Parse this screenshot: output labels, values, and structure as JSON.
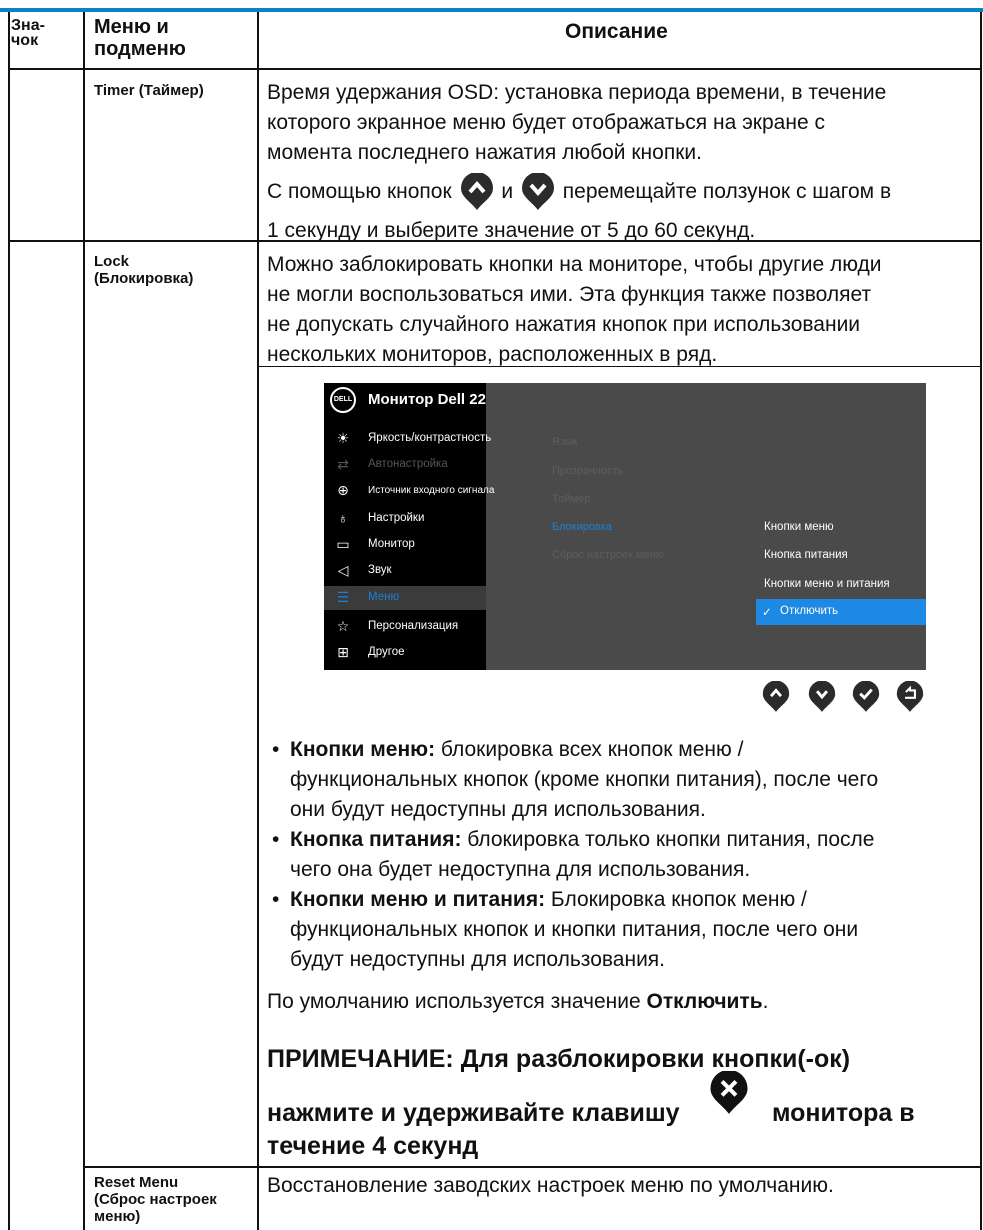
{
  "header": {
    "icon_col": "Зна-\nчок",
    "menu_col": "Меню и\nподменю",
    "desc_col": "Описание"
  },
  "rows": {
    "timer": {
      "label": "Timer (Таймер)",
      "line1": "Время удержания OSD: установка периода времени, в течение",
      "line2": "которого экранное меню будет отображаться на экране с",
      "line3": "момента последнего нажатия любой кнопки.",
      "line4a": "С помощью кнопок",
      "line4b": "и",
      "line4c": "перемещайте ползунок с шагом в",
      "line5": "1 секунду и выберите значение от 5 до 60 секунд."
    },
    "lock": {
      "label1": "Lock",
      "label2": "(Блокировка)",
      "line1": "Можно заблокировать кнопки на мониторе, чтобы другие люди",
      "line2": "не могли воспользоваться ими. Эта функция также позволяет",
      "line3": "не допускать случайного нажатия кнопок при использовании",
      "line4": "нескольких мониторов, расположенных в ряд.",
      "bullets": [
        {
          "bold": "Кнопки меню:",
          "l1": " блокировка всех кнопок меню /",
          "l2": "функциональных кнопок (кроме кнопки питания), после чего",
          "l3": "они будут недоступны для использования."
        },
        {
          "bold": "Кнопка питания:",
          "l1": " блокировка только кнопки питания, после",
          "l2": "чего она будет недоступна для использования.",
          "l3": ""
        },
        {
          "bold": "Кнопки меню и питания:",
          "l1": " Блокировка кнопок меню /",
          "l2": "функциональных кнопок и кнопки питания, после чего они",
          "l3": "будут недоступны для использования."
        }
      ],
      "default_pre": "По умолчанию используется значение ",
      "default_bold": "Отключить",
      "default_post": ".",
      "note1": "ПРИМЕЧАНИЕ: Для разблокировки кнопки(-ок)",
      "note2a": "нажмите и удерживайте клавишу",
      "note2b": "монитора в",
      "note3": "течение 4 секунд"
    },
    "reset": {
      "label1": "Reset Menu",
      "label2": "(Сброс настроек",
      "label3": "меню)",
      "desc": "Восстановление заводских настроек меню по умолчанию."
    }
  },
  "osd": {
    "logo": "DELL",
    "title": "Монитор Dell 22",
    "left_items": [
      {
        "icon": "sun-icon",
        "label": "Яркость/контрастность"
      },
      {
        "icon": "auto-adjust-icon",
        "label": "Автонастройка"
      },
      {
        "icon": "input-source-icon",
        "label": "Источник входного сигнала"
      },
      {
        "icon": "color-icon",
        "label": "Настройки"
      },
      {
        "icon": "monitor-icon",
        "label": "Монитор"
      },
      {
        "icon": "speaker-icon",
        "label": "Звук"
      },
      {
        "icon": "menu-icon",
        "label": "Меню"
      },
      {
        "icon": "star-icon",
        "label": "Персонализация"
      },
      {
        "icon": "other-icon",
        "label": "Другое"
      }
    ],
    "mid_items": [
      "Язык",
      "Прозрачность",
      "Таймер",
      "Блокировка",
      "Сброс настроек меню"
    ],
    "options": [
      "Кнопки меню",
      "Кнопка питания",
      "Кнопки меню и питания",
      "Отключить"
    ],
    "selected_option_check": "✓",
    "colors": {
      "accent": "#1e88e5",
      "panel": "#4a4a4a",
      "rule": "#0a84c6"
    }
  }
}
